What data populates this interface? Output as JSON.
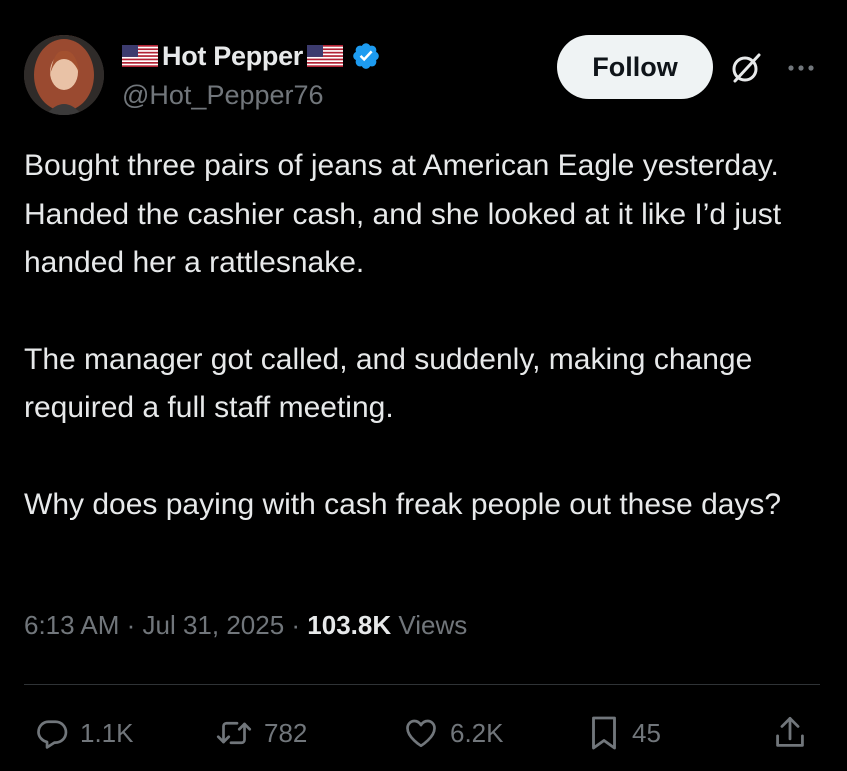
{
  "author": {
    "display_name": "Hot Pepper",
    "handle": "@Hot_Pepper76",
    "verified": true,
    "avatar_icon": "avatar-photo",
    "name_decoration_icons": [
      "us-flag-icon",
      "us-flag-icon"
    ]
  },
  "header": {
    "follow_label": "Follow",
    "grok_icon": "grok-icon",
    "more_icon": "more-icon"
  },
  "tweet": {
    "paragraphs": [
      "Bought three pairs of jeans at American Eagle yesterday. Handed the cashier cash, and she looked at it like I’d just handed her a rattlesnake.",
      "The manager got called, and suddenly, making change required a full staff meeting.",
      "Why does paying with cash freak people out these days?"
    ]
  },
  "meta": {
    "time": "6:13 AM",
    "separator": " · ",
    "date": "Jul 31, 2025",
    "views_count": "103.8K",
    "views_label": " Views"
  },
  "actions": {
    "reply": {
      "icon": "reply-icon",
      "count": "1.1K"
    },
    "repost": {
      "icon": "repost-icon",
      "count": "782"
    },
    "like": {
      "icon": "heart-icon",
      "count": "6.2K"
    },
    "bookmark": {
      "icon": "bookmark-icon",
      "count": "45"
    },
    "share": {
      "icon": "share-icon"
    }
  },
  "colors": {
    "background": "#000000",
    "primary_text": "#e7e9ea",
    "secondary_text": "#71767b",
    "verified_blue": "#1d9bf0",
    "follow_bg": "#eff3f4",
    "divider": "#2f3336"
  }
}
